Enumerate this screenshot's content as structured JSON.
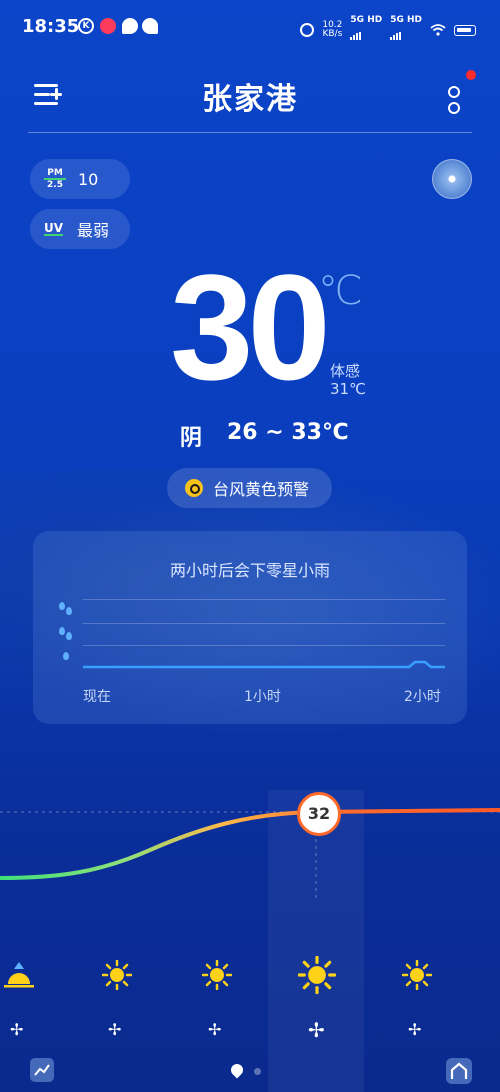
{
  "status_bar": {
    "time": "18:35",
    "net_speed_value": "10.2",
    "net_speed_unit": "KB/s",
    "sim1": "5G HD",
    "sim2": "5G HD"
  },
  "header": {
    "city": "张家港"
  },
  "air": {
    "pm_label_top": "PM",
    "pm_label_bottom": "2.5",
    "pm_value": "10",
    "uv_label": "UV",
    "uv_value": "最弱"
  },
  "current": {
    "temperature": "30",
    "unit": "℃",
    "feels_label": "体感",
    "feels_value": "31℃",
    "condition": "阴",
    "range": "26 ~ 33℃"
  },
  "alert": {
    "text": "台风黄色预警",
    "color": "#f6c21b"
  },
  "rain_card": {
    "title": "两小时后会下零星小雨",
    "time_labels": [
      "现在",
      "1小时",
      "2小时"
    ]
  },
  "hourly": {
    "highlight_temp": "32",
    "icons": [
      "sunrise-icon",
      "sun-icon",
      "sun-icon",
      "sun-icon",
      "sun-icon"
    ],
    "wind_icons": [
      "fan-icon",
      "fan-icon",
      "fan-icon",
      "fan-icon",
      "fan-icon"
    ]
  },
  "colors": {
    "accent_green": "#3fd46f",
    "line_start": "#3fe07a",
    "line_end": "#ff6a2a",
    "sun": "#ffd21a",
    "alert_dot": "#ff2a2a"
  }
}
